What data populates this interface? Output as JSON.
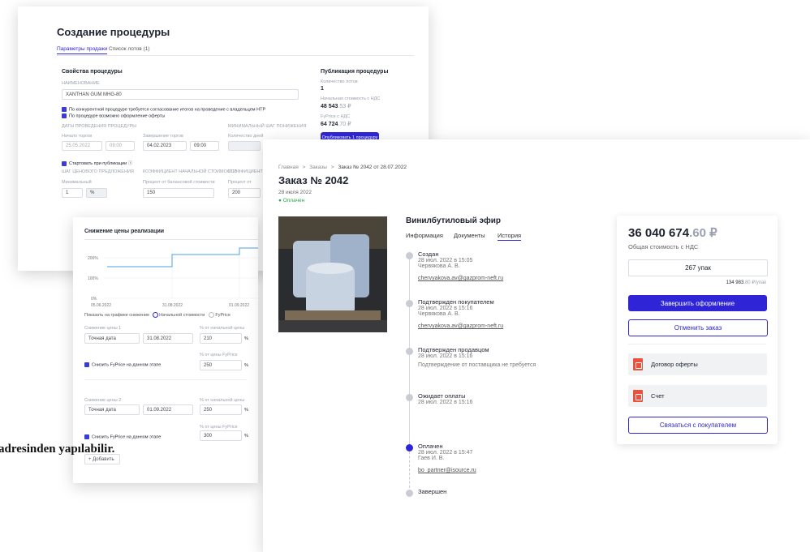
{
  "panel1": {
    "title": "Создание процедуры",
    "tabs": [
      "Параметры продажи",
      "Список лотов (1)"
    ],
    "section_title": "Свойства процедуры",
    "name_label": "НАИМЕНОВАНИЕ",
    "name_value": "XANTHAN GUM MHG-80",
    "checkbox1": "По конкурентной процедуре требуется согласование итогов на проведение с владельцем НТР",
    "checkbox2": "По процедуре возможно оформление оферты",
    "dates_label": "ДАТЫ ПРОВЕДЕНИЯ ПРОЦЕДУРЫ",
    "start_label": "Начало торгов",
    "start_date": "25.05.2022",
    "start_time": "09:00",
    "end_label": "Завершение торгов",
    "end_date": "04.02.2023",
    "end_time": "09:00",
    "min_step_label": "МИНИМАЛЬНЫЙ ШАГ ПОНИЖЕНИЯ",
    "qty_label": "Количество дней",
    "start_on_publish": "Стартовать при публикации",
    "price_step_label": "ШАГ ЦЕНОВОГО ПРЕДЛОЖЕНИЯ",
    "coef_label": "КОЭФФИЦИЕНТ НАЧАЛЬНОЙ СТОИМОСТИ",
    "coef2_label": "КОЭФФИЦИЕНТ",
    "min_label": "Минимальный",
    "min_value": "1",
    "min_unit": "%",
    "percent_label": "Процент от балансовой стоимости",
    "percent_value": "150",
    "percent2_label": "Процент от",
    "percent2_value": "200",
    "pub_title": "Публикация процедуры",
    "lots_label": "Количество лотов",
    "lots_value": "1",
    "start_cost_label": "Начальная стоимость с НДС",
    "start_cost_value": "48 543",
    "start_cost_kop": ".53 ₽",
    "fyprice_label": "FyPrice с НДС",
    "fyprice_value": "64 724",
    "fyprice_kop": ".70 ₽",
    "publish_btn": "Опубликовать 1 процедуру"
  },
  "panel2": {
    "title": "Снижение цены реализации",
    "y_ticks": [
      "200%",
      "100%",
      "0%"
    ],
    "x_ticks": [
      "05.06.2022",
      "31.08.2022",
      "01.09.2022"
    ],
    "show_label": "Показать на графике снижение",
    "radio1": "Начальной стоимости",
    "radio2": "FyPrice",
    "stage1_label": "Снижение цены 1",
    "stage1_type": "Точная дата",
    "stage1_date": "31.08.2022",
    "stage1_pct_label": "% от начальной цены",
    "stage1_pct": "210",
    "stage1_fy_label": "% от цены FyPrice",
    "stage1_fy": "250",
    "stage_check": "Снизить FyPrice на данном этапе",
    "stage2_label": "Снижение цены 2",
    "stage2_type": "Точная дата",
    "stage2_date": "01.09.2022",
    "stage2_pct_label": "% от начальной цены",
    "stage2_pct": "250",
    "stage2_fy_label": "% от цены FyPrice",
    "stage2_fy": "300",
    "add_btn": "+ Добавить",
    "pct": "%"
  },
  "overlay_text": "adresinden yapılabilir.",
  "order": {
    "breadcrumb": [
      "Главная",
      "Заказы",
      "Заказ № 2042 от 28.07.2022"
    ],
    "breadcrumb_sep": ">",
    "title": "Заказ № 2042",
    "date": "28 июля 2022",
    "status": "Оплачен",
    "product": "Винилбутиловый эфир",
    "tabs": [
      "Информация",
      "Документы",
      "История"
    ],
    "history": [
      {
        "title": "Создан",
        "time": "28 июл. 2022 в 15:05",
        "person": "Червякова А. В.",
        "email": "chervyakova.av@gazprom-neft.ru"
      },
      {
        "title": "Подтвержден покупателем",
        "time": "28 июл. 2022 в 15:16",
        "person": "Червякова А. В.",
        "email": "chervyakova.av@gazprom-neft.ru"
      },
      {
        "title": "Подтвержден продавцом",
        "time": "28 июл. 2022 в 15:16",
        "person": "Подтверждение от поставщика не требуется",
        "email": ""
      },
      {
        "title": "Ожидает оплаты",
        "time": "28 июл. 2022 в 15:16",
        "person": "",
        "email": ""
      },
      {
        "title": "Оплачен",
        "time": "28 июл. 2022 в 15:47",
        "person": "Гаев И. В.",
        "email": "bo_partner@isource.ru"
      },
      {
        "title": "Завершен",
        "time": "",
        "person": "",
        "email": ""
      }
    ],
    "total_main": "36 040 674",
    "total_kop": ".60 ₽",
    "total_label": "Общая стоимость с НДС",
    "qty": "267 упак",
    "unit_price_main": "134 983",
    "unit_price_rest": ".80 ₽/упак",
    "finish_btn": "Завершить оформление",
    "cancel_btn": "Отменить заказ",
    "docs": [
      "Договор оферты",
      "Счет"
    ],
    "contact_btn": "Связаться с покупателем"
  },
  "colors": {
    "accent": "#2f25d6",
    "status_green": "#2aa84a",
    "line": "#4aa3df"
  }
}
